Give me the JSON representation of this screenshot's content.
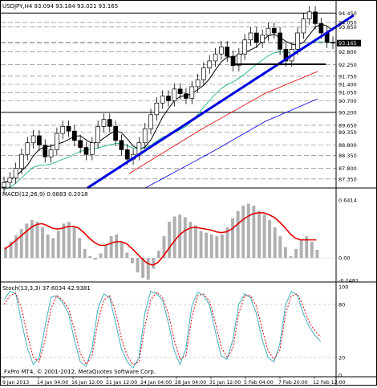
{
  "header": {
    "symbol_info": "USDJPY,H4  93.094 93.184 93.021 93.165"
  },
  "indicators": {
    "macd_label": "MACD(12,26,9) 0.0883 0.2018",
    "stoch_label": "Stoch(13,3,3) 37.6034 42.9381"
  },
  "footer": {
    "watermark": "FxPro MT4, © 2001-2012, MetaQuotes Software Corp."
  },
  "price_axis": {
    "labels": [
      "94.450",
      "94.050",
      "93.850",
      "93.200",
      "93.165",
      "92.800",
      "92.250",
      "91.750",
      "91.400",
      "91.050",
      "90.700",
      "90.200",
      "89.650",
      "89.350",
      "88.800",
      "88.350",
      "87.800",
      "87.350"
    ],
    "highlighted": "93.165"
  },
  "macd_axis": {
    "labels": [
      "0.6414",
      "0.00",
      "-0.2481"
    ]
  },
  "stoch_axis": {
    "labels": [
      "100",
      "80",
      "20",
      "0"
    ]
  },
  "time_axis": {
    "labels": [
      "9 Jan 2013",
      "14 Jan 04:00",
      "16 Jan 12:00",
      "21 Jan 12:00",
      "24 Jan 04:00",
      "28 Jan 04:00",
      "31 Jan 12:00",
      "5 Feb 04:00",
      "7 Feb 20:00",
      "12 Feb 12:00"
    ]
  },
  "colors": {
    "trendline": "#0000e0",
    "support": "#000000",
    "macd_signal": "#e00000",
    "macd_hist": "#b0b0b0",
    "ma_black": "#000000",
    "ma_green": "#00b070",
    "ma_red": "#e00000",
    "ma_blue": "#0000e0",
    "stoch_main": "#40b0c0",
    "stoch_signal": "#e00000"
  },
  "chart_data": {
    "type": "line",
    "title": "USDJPY,H4",
    "close_prices": [
      87.2,
      87.4,
      87.8,
      88.4,
      88.9,
      89.2,
      88.8,
      88.3,
      88.6,
      89.3,
      89.6,
      89.4,
      89.0,
      88.7,
      88.4,
      88.9,
      89.6,
      89.9,
      89.6,
      89.0,
      88.6,
      88.2,
      88.4,
      88.9,
      89.5,
      90.1,
      90.6,
      90.9,
      90.7,
      91.2,
      91.0,
      90.8,
      91.3,
      91.6,
      92.1,
      92.4,
      92.7,
      93.0,
      92.6,
      92.2,
      92.7,
      93.3,
      93.6,
      93.2,
      93.5,
      93.8,
      93.6,
      92.9,
      92.4,
      92.9,
      93.6,
      94.2,
      94.5,
      94.0,
      93.6,
      93.2,
      93.165
    ],
    "macd_histogram": [
      0.12,
      0.18,
      0.25,
      0.32,
      0.38,
      0.42,
      0.4,
      0.34,
      0.26,
      0.22,
      0.3,
      0.38,
      0.4,
      0.34,
      0.22,
      0.1,
      0.02,
      -0.02,
      0.05,
      0.15,
      0.24,
      0.26,
      0.18,
      0.06,
      -0.06,
      -0.16,
      -0.22,
      -0.24,
      -0.12,
      0.08,
      0.24,
      0.4,
      0.46,
      0.48,
      0.45,
      0.4,
      0.36,
      0.3,
      0.28,
      0.26,
      0.24,
      0.26,
      0.34,
      0.44,
      0.52,
      0.58,
      0.6,
      0.58,
      0.52,
      0.48,
      0.42,
      0.34,
      0.24,
      0.12,
      0.02,
      0.1,
      0.2,
      0.24,
      0.18,
      0.09
    ],
    "macd_signal": [
      0.1,
      0.14,
      0.19,
      0.24,
      0.29,
      0.34,
      0.37,
      0.38,
      0.36,
      0.33,
      0.32,
      0.33,
      0.35,
      0.35,
      0.33,
      0.28,
      0.22,
      0.17,
      0.14,
      0.14,
      0.16,
      0.18,
      0.18,
      0.16,
      0.11,
      0.05,
      -0.01,
      -0.06,
      -0.08,
      -0.05,
      0.02,
      0.1,
      0.18,
      0.25,
      0.3,
      0.33,
      0.34,
      0.33,
      0.32,
      0.31,
      0.29,
      0.28,
      0.29,
      0.32,
      0.37,
      0.42,
      0.46,
      0.49,
      0.5,
      0.5,
      0.48,
      0.45,
      0.4,
      0.34,
      0.27,
      0.22,
      0.2,
      0.2,
      0.2,
      0.2
    ],
    "stoch_main": [
      85,
      95,
      92,
      60,
      30,
      12,
      20,
      55,
      88,
      90,
      82,
      70,
      40,
      15,
      10,
      30,
      75,
      92,
      88,
      60,
      30,
      15,
      8,
      20,
      70,
      95,
      92,
      85,
      60,
      28,
      12,
      30,
      78,
      94,
      90,
      80,
      50,
      22,
      18,
      40,
      80,
      92,
      88,
      70,
      40,
      20,
      15,
      35,
      80,
      95,
      90,
      70,
      55,
      45,
      38
    ],
    "stoch_signal": [
      80,
      90,
      93,
      75,
      45,
      20,
      15,
      40,
      75,
      90,
      85,
      75,
      52,
      25,
      12,
      22,
      60,
      85,
      90,
      72,
      42,
      22,
      12,
      15,
      55,
      85,
      94,
      88,
      70,
      40,
      18,
      22,
      65,
      90,
      92,
      84,
      60,
      32,
      20,
      30,
      70,
      90,
      90,
      78,
      52,
      28,
      18,
      28,
      70,
      90,
      92,
      78,
      60,
      50,
      43
    ],
    "ylim": [
      87.0,
      94.7
    ]
  }
}
